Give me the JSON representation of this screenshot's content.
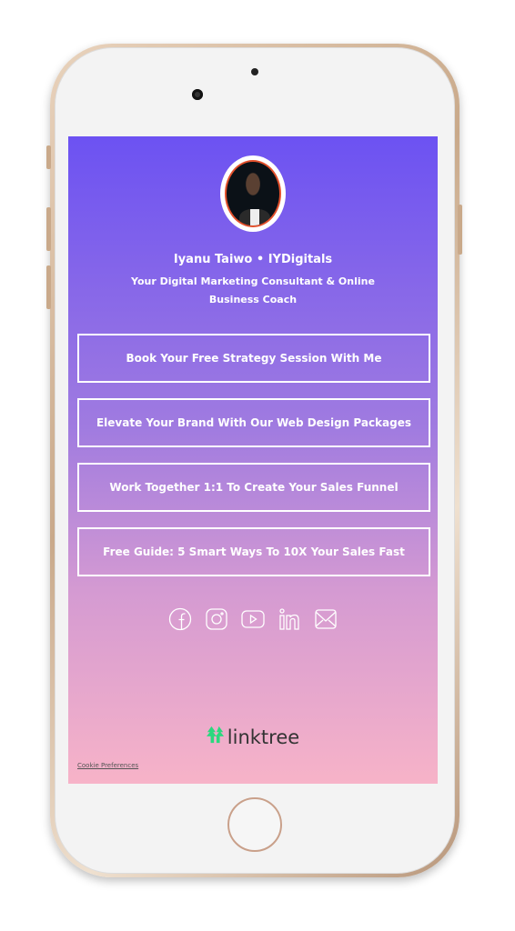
{
  "profile": {
    "name": "Iyanu Taiwo • IYDigitals",
    "bio": "Your Digital Marketing Consultant & Online Business Coach"
  },
  "links": [
    {
      "label": "Book Your Free Strategy Session With Me"
    },
    {
      "label": "Elevate Your Brand With Our Web Design Packages"
    },
    {
      "label": "Work Together 1:1 To Create Your Sales Funnel"
    },
    {
      "label": "Free Guide: 5 Smart Ways To 10X Your Sales Fast"
    }
  ],
  "socials": [
    "facebook-icon",
    "instagram-icon",
    "youtube-icon",
    "linkedin-icon",
    "email-icon"
  ],
  "footer": {
    "logo": "linktree",
    "cookie": "Cookie Preferences"
  },
  "colors": {
    "gradient_top": "#6c52f2",
    "gradient_bottom": "#f7b3c8",
    "linktree_green": "#2bd87e"
  }
}
